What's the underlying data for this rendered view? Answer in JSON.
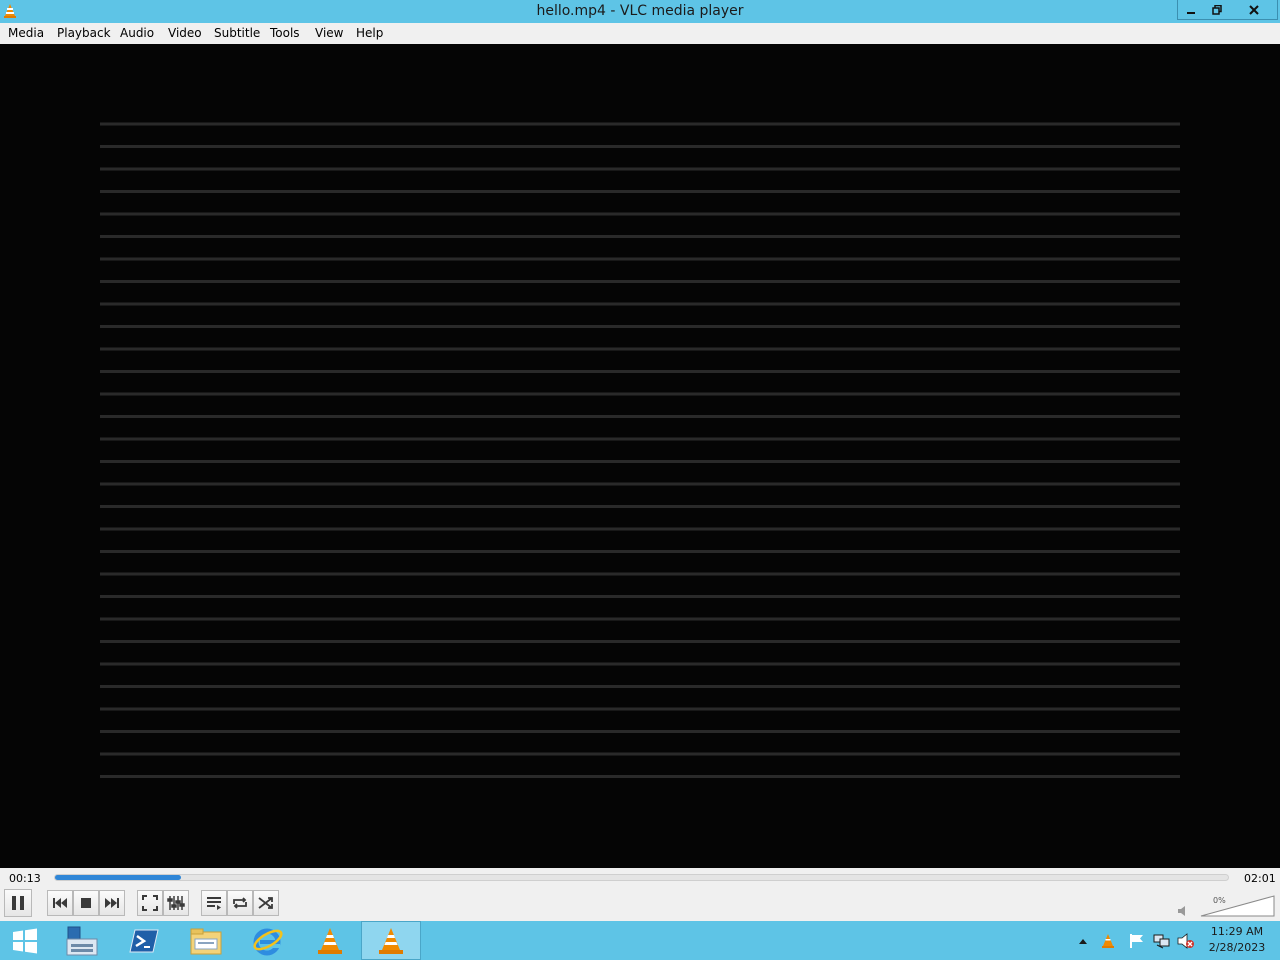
{
  "window": {
    "title": "hello.mp4 - VLC media player",
    "icon": "vlc-cone-icon",
    "buttons": [
      "minimize-icon",
      "restore-icon",
      "close-icon"
    ]
  },
  "menu": [
    {
      "label": "Media"
    },
    {
      "label": "Playback"
    },
    {
      "label": "Audio"
    },
    {
      "label": "Video"
    },
    {
      "label": "Subtitle"
    },
    {
      "label": "Tools"
    },
    {
      "label": "View"
    },
    {
      "label": "Help"
    }
  ],
  "player": {
    "elapsed": "00:13",
    "duration": "02:01",
    "progress_fraction": 0.107,
    "volume_label": "0%"
  },
  "controls": [
    "pause-icon",
    "previous-icon",
    "stop-icon",
    "next-icon",
    "fullscreen-icon",
    "extended-settings-icon",
    "playlist-icon",
    "loop-icon",
    "random-icon"
  ],
  "taskbar": {
    "apps": [
      "windows-start-icon",
      "server-manager-icon",
      "powershell-icon",
      "file-explorer-icon",
      "internet-explorer-icon",
      "vlc-icon",
      "vlc-icon"
    ],
    "tray_icons": [
      "show-hidden-icons-arrow",
      "vlc-tray-icon",
      "action-center-flag-icon",
      "network-icon",
      "speaker-muted-icon"
    ],
    "time": "11:29 AM",
    "date": "2/28/2023"
  },
  "colors": {
    "accent": "#5ec4e6",
    "progress": "#2f86d7",
    "vlc_orange": "#f08a00"
  }
}
